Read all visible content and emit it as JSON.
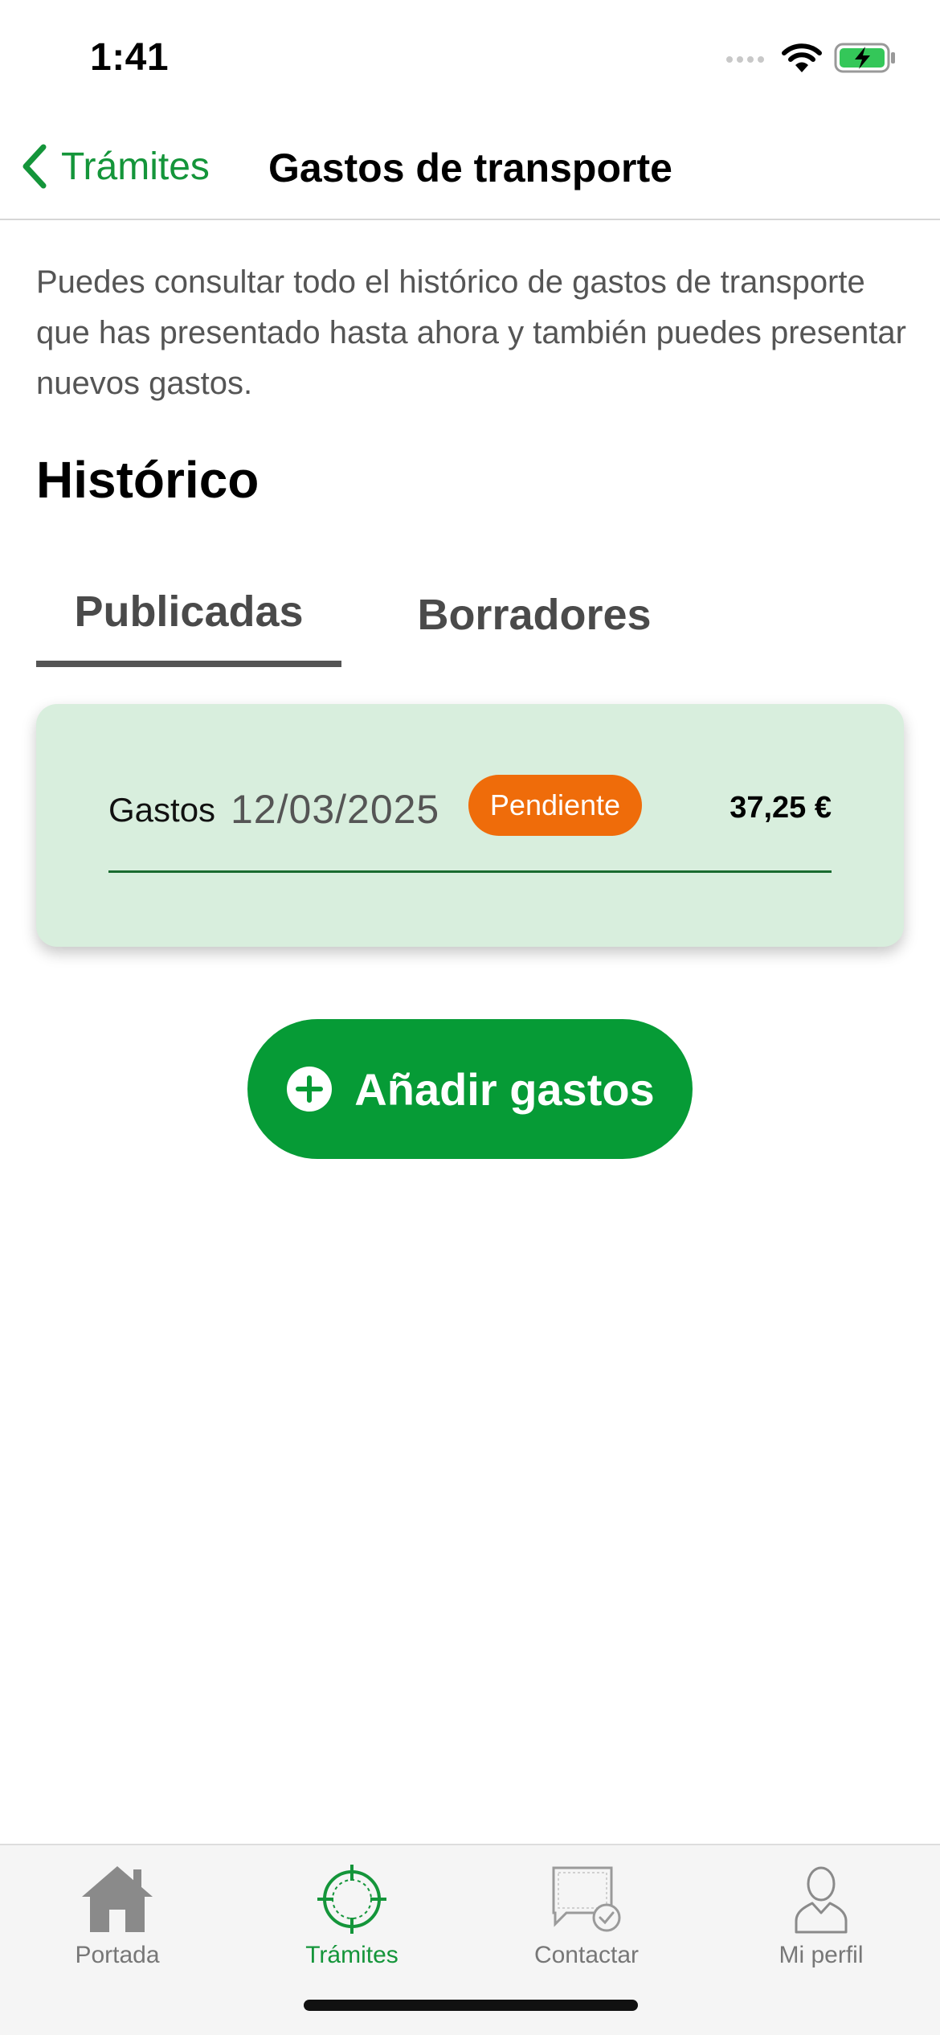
{
  "status_bar": {
    "time": "1:41"
  },
  "nav": {
    "back_label": "Trámites",
    "title": "Gastos de transporte"
  },
  "content": {
    "intro": "Puedes consultar todo el histórico de gastos de transporte que has presentado hasta ahora y también puedes presentar nuevos gastos.",
    "section_title": "Histórico",
    "tabs": [
      {
        "label": "Publicadas",
        "selected": true
      },
      {
        "label": "Borradores",
        "selected": false
      }
    ],
    "records": [
      {
        "label": "Gastos",
        "date": "12/03/2025",
        "status": "Pendiente",
        "amount": "37,25 €"
      }
    ],
    "add_button": "Añadir gastos"
  },
  "tab_bar": {
    "items": [
      {
        "label": "Portada",
        "icon": "home-icon",
        "active": false
      },
      {
        "label": "Trámites",
        "icon": "crosshair-icon",
        "active": true
      },
      {
        "label": "Contactar",
        "icon": "chat-check-icon",
        "active": false
      },
      {
        "label": "Mi perfil",
        "icon": "person-icon",
        "active": false
      }
    ]
  },
  "colors": {
    "accent_green": "#14953a",
    "button_green": "#069b36",
    "card_background": "#d8eedd",
    "badge_orange": "#ef6c0a"
  }
}
